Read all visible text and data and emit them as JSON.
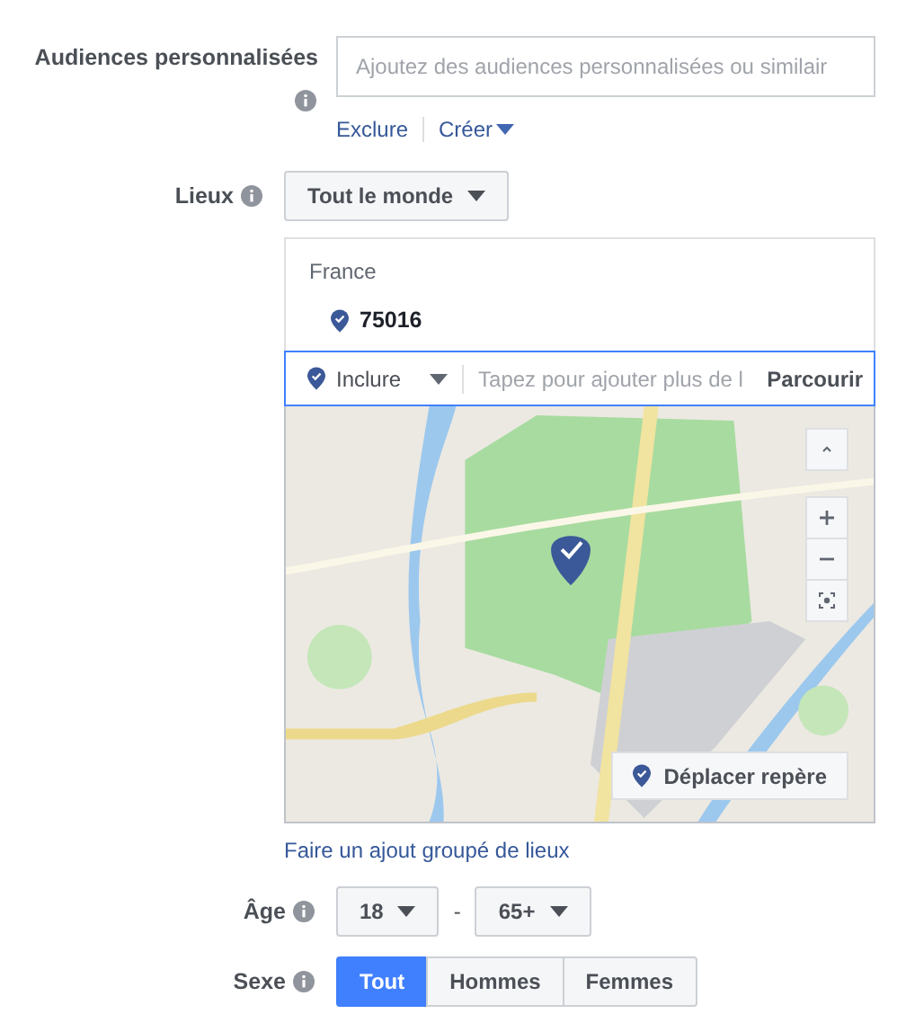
{
  "custom_audiences": {
    "label": "Audiences personnalisées",
    "placeholder": "Ajoutez des audiences personnalisées ou similair",
    "links": [
      {
        "label": "Exclure",
        "dropdown": false
      },
      {
        "label": "Créer",
        "dropdown": true
      }
    ]
  },
  "locations": {
    "label": "Lieux",
    "scope": "Tout le monde",
    "country": "France",
    "places": [
      "75016"
    ],
    "mode": "Inclure",
    "placeholder": "Tapez pour ajouter plus de l",
    "browse": "Parcourir",
    "map": {
      "controls": [
        {
          "kind": "up"
        },
        {
          "kind": "zoom-in"
        },
        {
          "kind": "zoom-out"
        },
        {
          "kind": "locate"
        }
      ],
      "move_pin": "Déplacer repère"
    },
    "bulk_link": "Faire un ajout groupé de lieux"
  },
  "age": {
    "label": "Âge",
    "min": "18",
    "separator": "-",
    "max": "65+"
  },
  "gender": {
    "label": "Sexe",
    "options": [
      {
        "label": "Tout",
        "selected": true
      },
      {
        "label": "Hommes",
        "selected": false
      },
      {
        "label": "Femmes",
        "selected": false
      }
    ]
  }
}
